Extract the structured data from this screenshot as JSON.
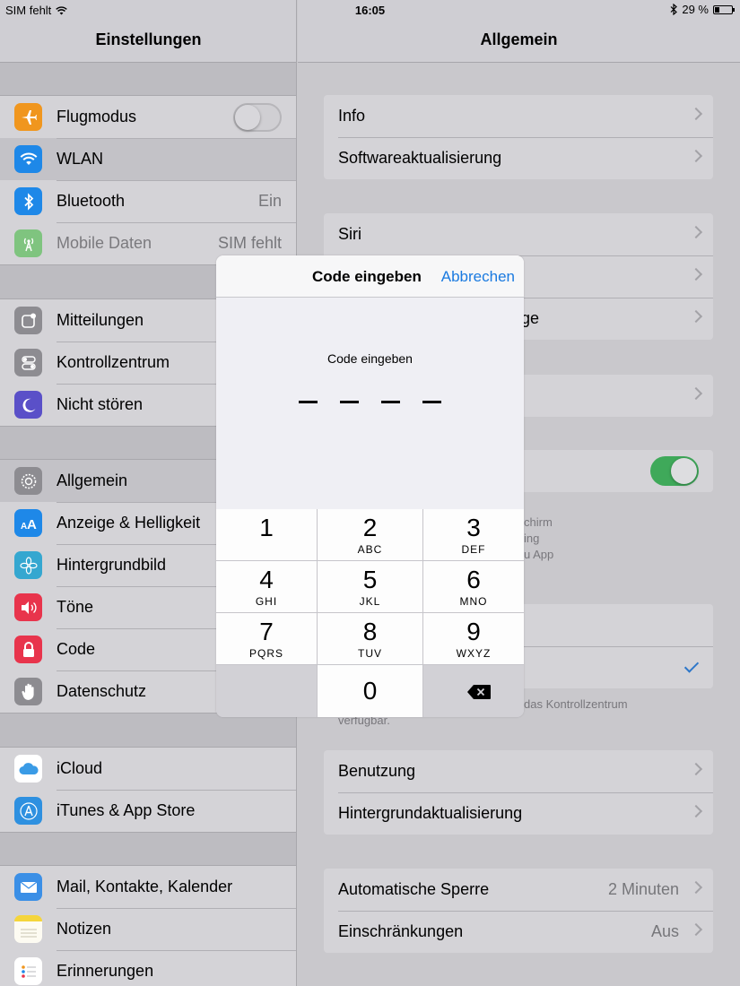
{
  "status": {
    "carrier": "SIM fehlt",
    "time": "16:05",
    "battery": "29 %",
    "battery_level": 0.29
  },
  "left": {
    "title": "Einstellungen",
    "items": [
      {
        "label": "Flugmodus",
        "icon": "airplane-icon",
        "color": "#f0961e",
        "control": "toggle-off"
      },
      {
        "label": "WLAN",
        "icon": "wifi-icon",
        "color": "#1e88e8"
      },
      {
        "label": "Bluetooth",
        "icon": "bluetooth-icon",
        "color": "#1e88e8",
        "value": "Ein"
      },
      {
        "label": "Mobile Daten",
        "icon": "antenna-icon",
        "color": "#7fc47f",
        "value": "SIM fehlt",
        "disabled": true
      },
      {
        "label": "Mitteilungen",
        "icon": "notifications-icon",
        "color": "#8d8c91"
      },
      {
        "label": "Kontrollzentrum",
        "icon": "control-center-icon",
        "color": "#8d8c91"
      },
      {
        "label": "Nicht stören",
        "icon": "moon-icon",
        "color": "#5a50c8"
      },
      {
        "label": "Allgemein",
        "icon": "gear-icon",
        "color": "#8d8c91"
      },
      {
        "label": "Anzeige & Helligkeit",
        "icon": "display-icon",
        "color": "#1e88e8"
      },
      {
        "label": "Hintergrundbild",
        "icon": "flower-icon",
        "color": "#35a7d0"
      },
      {
        "label": "Töne",
        "icon": "speaker-icon",
        "color": "#e8344c"
      },
      {
        "label": "Code",
        "icon": "lock-icon",
        "color": "#e8344c"
      },
      {
        "label": "Datenschutz",
        "icon": "hand-icon",
        "color": "#8d8c91"
      },
      {
        "label": "iCloud",
        "icon": "cloud-icon",
        "color": "#ffffff"
      },
      {
        "label": "iTunes & App Store",
        "icon": "app-store-icon",
        "color": "#2e90e0"
      },
      {
        "label": "Mail, Kontakte, Kalender",
        "icon": "mail-icon",
        "color": "#3b8fe6"
      },
      {
        "label": "Notizen",
        "icon": "notes-icon",
        "color": "#f5d53c"
      },
      {
        "label": "Erinnerungen",
        "icon": "reminders-icon",
        "color": "#ffffff"
      }
    ]
  },
  "right": {
    "title": "Allgemein",
    "rows": {
      "info": "Info",
      "update": "Softwareaktualisierung",
      "siri": "Siri",
      "partial_ge": "ge",
      "note_chirm": "chirm",
      "note_ing": "ing",
      "note_app": "u App",
      "foot_kz": "das Kontrollzentrum",
      "foot_verf": "verfügbar.",
      "usage": "Benutzung",
      "bg_refresh": "Hintergrundaktualisierung",
      "autolock": "Automatische Sperre",
      "autolock_value": "2 Minuten",
      "restrictions": "Einschränkungen",
      "restrictions_value": "Aus"
    }
  },
  "dialog": {
    "title": "Code eingeben",
    "cancel": "Abbrechen",
    "prompt": "Code eingeben",
    "keys": [
      {
        "num": "1",
        "letters": ""
      },
      {
        "num": "2",
        "letters": "ABC"
      },
      {
        "num": "3",
        "letters": "DEF"
      },
      {
        "num": "4",
        "letters": "GHI"
      },
      {
        "num": "5",
        "letters": "JKL"
      },
      {
        "num": "6",
        "letters": "MNO"
      },
      {
        "num": "7",
        "letters": "PQRS"
      },
      {
        "num": "8",
        "letters": "TUV"
      },
      {
        "num": "9",
        "letters": "WXYZ"
      },
      {
        "num": "0",
        "letters": ""
      }
    ]
  }
}
